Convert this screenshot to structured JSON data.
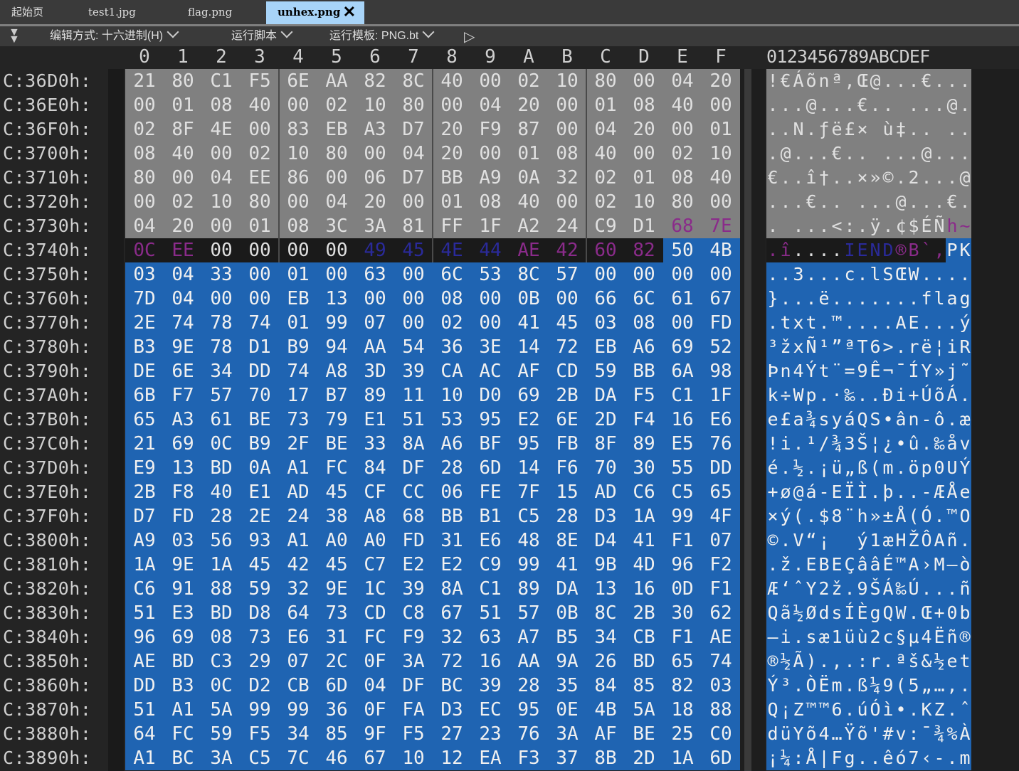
{
  "tabs": [
    {
      "label": "起始页",
      "active": false
    },
    {
      "label": "test1.jpg",
      "active": false
    },
    {
      "label": "flag.png",
      "active": false
    },
    {
      "label": "unhex.png",
      "active": true
    }
  ],
  "toolbar": {
    "edit_mode": "编辑方式: 十六进制(H)",
    "run_script": "运行脚本",
    "run_template": "运行模板: PNG.bt"
  },
  "column_headers": [
    "0",
    "1",
    "2",
    "3",
    "4",
    "5",
    "6",
    "7",
    "8",
    "9",
    "A",
    "B",
    "C",
    "D",
    "E",
    "F"
  ],
  "ascii_header": "0123456789ABCDEF",
  "colors": {
    "gray_bg": "#808080",
    "gray_fg": "#e0e0e0",
    "blue_bg": "#1f64b2",
    "blue_fg": "#f0f0f0",
    "black_bg": "#1a1a1a",
    "black_fg": "#e0e0e0",
    "purple_fg": "#8a2b8a",
    "navy_fg": "#2a2a9a"
  },
  "rows": [
    {
      "addr": "C:36D0h:",
      "hex": [
        "21",
        "80",
        "C1",
        "F5",
        "6E",
        "AA",
        "82",
        "8C",
        "40",
        "00",
        "02",
        "10",
        "80",
        "00",
        "04",
        "20"
      ],
      "ascii": "!€Áõnª‚Œ@...€..."
    },
    {
      "addr": "C:36E0h:",
      "hex": [
        "00",
        "01",
        "08",
        "40",
        "00",
        "02",
        "10",
        "80",
        "00",
        "04",
        "20",
        "00",
        "01",
        "08",
        "40",
        "00"
      ],
      "ascii": "...@...€.. ...@."
    },
    {
      "addr": "C:36F0h:",
      "hex": [
        "02",
        "8F",
        "4E",
        "00",
        "83",
        "EB",
        "A3",
        "D7",
        "20",
        "F9",
        "87",
        "00",
        "04",
        "20",
        "00",
        "01"
      ],
      "ascii": "..N.ƒë£× ù‡.. .."
    },
    {
      "addr": "C:3700h:",
      "hex": [
        "08",
        "40",
        "00",
        "02",
        "10",
        "80",
        "00",
        "04",
        "20",
        "00",
        "01",
        "08",
        "40",
        "00",
        "02",
        "10"
      ],
      "ascii": ".@...€.. ...@..."
    },
    {
      "addr": "C:3710h:",
      "hex": [
        "80",
        "00",
        "04",
        "EE",
        "86",
        "00",
        "06",
        "D7",
        "BB",
        "A9",
        "0A",
        "32",
        "02",
        "01",
        "08",
        "40"
      ],
      "ascii": "€..î†..×»©.2...@"
    },
    {
      "addr": "C:3720h:",
      "hex": [
        "00",
        "02",
        "10",
        "80",
        "00",
        "04",
        "20",
        "00",
        "01",
        "08",
        "40",
        "00",
        "02",
        "10",
        "80",
        "00"
      ],
      "ascii": "...€.. ...@...€."
    },
    {
      "addr": "C:3730h:",
      "hex": [
        "04",
        "20",
        "00",
        "01",
        "08",
        "3C",
        "3A",
        "81",
        "FF",
        "1F",
        "A2",
        "24",
        "C9",
        "D1",
        "68",
        "7E"
      ],
      "ascii": ". ...<:.ÿ.¢$ÉÑh~"
    },
    {
      "addr": "C:3740h:",
      "hex": [
        "0C",
        "EE",
        "00",
        "00",
        "00",
        "00",
        "49",
        "45",
        "4E",
        "44",
        "AE",
        "42",
        "60",
        "82",
        "50",
        "4B"
      ],
      "ascii": ".î....IEND®B`‚PK"
    },
    {
      "addr": "C:3750h:",
      "hex": [
        "03",
        "04",
        "33",
        "00",
        "01",
        "00",
        "63",
        "00",
        "6C",
        "53",
        "8C",
        "57",
        "00",
        "00",
        "00",
        "00"
      ],
      "ascii": "..3...c.lSŒW...."
    },
    {
      "addr": "C:3760h:",
      "hex": [
        "7D",
        "04",
        "00",
        "00",
        "EB",
        "13",
        "00",
        "00",
        "08",
        "00",
        "0B",
        "00",
        "66",
        "6C",
        "61",
        "67"
      ],
      "ascii": "}...ë.......flag"
    },
    {
      "addr": "C:3770h:",
      "hex": [
        "2E",
        "74",
        "78",
        "74",
        "01",
        "99",
        "07",
        "00",
        "02",
        "00",
        "41",
        "45",
        "03",
        "08",
        "00",
        "FD"
      ],
      "ascii": ".txt.™....AE...ý"
    },
    {
      "addr": "C:3780h:",
      "hex": [
        "B3",
        "9E",
        "78",
        "D1",
        "B9",
        "94",
        "AA",
        "54",
        "36",
        "3E",
        "14",
        "72",
        "EB",
        "A6",
        "69",
        "52"
      ],
      "ascii": "³žxÑ¹”ªT6>.rë¦iR"
    },
    {
      "addr": "C:3790h:",
      "hex": [
        "DE",
        "6E",
        "34",
        "DD",
        "74",
        "A8",
        "3D",
        "39",
        "CA",
        "AC",
        "AF",
        "CD",
        "59",
        "BB",
        "6A",
        "98"
      ],
      "ascii": "Þn4Ýt¨=9Ê¬¯ÍY»j˜"
    },
    {
      "addr": "C:37A0h:",
      "hex": [
        "6B",
        "F7",
        "57",
        "70",
        "17",
        "B7",
        "89",
        "11",
        "10",
        "D0",
        "69",
        "2B",
        "DA",
        "F5",
        "C1",
        "1F"
      ],
      "ascii": "k÷Wp.·‰..Ði+ÚõÁ."
    },
    {
      "addr": "C:37B0h:",
      "hex": [
        "65",
        "A3",
        "61",
        "BE",
        "73",
        "79",
        "E1",
        "51",
        "53",
        "95",
        "E2",
        "6E",
        "2D",
        "F4",
        "16",
        "E6"
      ],
      "ascii": "e£a¾syáQS•ân-ô.æ"
    },
    {
      "addr": "C:37C0h:",
      "hex": [
        "21",
        "69",
        "0C",
        "B9",
        "2F",
        "BE",
        "33",
        "8A",
        "A6",
        "BF",
        "95",
        "FB",
        "8F",
        "89",
        "E5",
        "76"
      ],
      "ascii": "!i.¹/¾3Š¦¿•û.‰åv"
    },
    {
      "addr": "C:37D0h:",
      "hex": [
        "E9",
        "13",
        "BD",
        "0A",
        "A1",
        "FC",
        "84",
        "DF",
        "28",
        "6D",
        "14",
        "F6",
        "70",
        "30",
        "55",
        "DD"
      ],
      "ascii": "é.½.¡ü„ß(m.öp0UÝ"
    },
    {
      "addr": "C:37E0h:",
      "hex": [
        "2B",
        "F8",
        "40",
        "E1",
        "AD",
        "45",
        "CF",
        "CC",
        "06",
        "FE",
        "7F",
        "15",
        "AD",
        "C6",
        "C5",
        "65"
      ],
      "ascii": "+ø@á-EÏÌ.þ..-ÆÅe"
    },
    {
      "addr": "C:37F0h:",
      "hex": [
        "D7",
        "FD",
        "28",
        "2E",
        "24",
        "38",
        "A8",
        "68",
        "BB",
        "B1",
        "C5",
        "28",
        "D3",
        "1A",
        "99",
        "4F"
      ],
      "ascii": "×ý(.$8¨h»±Å(Ó.™O"
    },
    {
      "addr": "C:3800h:",
      "hex": [
        "A9",
        "03",
        "56",
        "93",
        "A1",
        "A0",
        "A0",
        "FD",
        "31",
        "E6",
        "48",
        "8E",
        "D4",
        "41",
        "F1",
        "07"
      ],
      "ascii": "©.V“¡  ý1æHŽÔAñ."
    },
    {
      "addr": "C:3810h:",
      "hex": [
        "1A",
        "9E",
        "1A",
        "45",
        "42",
        "45",
        "C7",
        "E2",
        "E2",
        "C9",
        "99",
        "41",
        "9B",
        "4D",
        "96",
        "F2"
      ],
      "ascii": ".ž.EBEÇââÉ™A›M–ò"
    },
    {
      "addr": "C:3820h:",
      "hex": [
        "C6",
        "91",
        "88",
        "59",
        "32",
        "9E",
        "1C",
        "39",
        "8A",
        "C1",
        "89",
        "DA",
        "13",
        "16",
        "0D",
        "F1"
      ],
      "ascii": "Æ‘ˆY2ž.9ŠÁ‰Ú...ñ"
    },
    {
      "addr": "C:3830h:",
      "hex": [
        "51",
        "E3",
        "BD",
        "D8",
        "64",
        "73",
        "CD",
        "C8",
        "67",
        "51",
        "57",
        "0B",
        "8C",
        "2B",
        "30",
        "62"
      ],
      "ascii": "Qã½ØdsÍÈgQW.Œ+0b"
    },
    {
      "addr": "C:3840h:",
      "hex": [
        "96",
        "69",
        "08",
        "73",
        "E6",
        "31",
        "FC",
        "F9",
        "32",
        "63",
        "A7",
        "B5",
        "34",
        "CB",
        "F1",
        "AE"
      ],
      "ascii": "–i.sæ1üù2c§µ4Ëñ®"
    },
    {
      "addr": "C:3850h:",
      "hex": [
        "AE",
        "BD",
        "C3",
        "29",
        "07",
        "2C",
        "0F",
        "3A",
        "72",
        "16",
        "AA",
        "9A",
        "26",
        "BD",
        "65",
        "74"
      ],
      "ascii": "®½Ã).,.:r.ªš&½et"
    },
    {
      "addr": "C:3860h:",
      "hex": [
        "DD",
        "B3",
        "0C",
        "D2",
        "CB",
        "6D",
        "04",
        "DF",
        "BC",
        "39",
        "28",
        "35",
        "84",
        "85",
        "82",
        "03"
      ],
      "ascii": "Ý³.ÒËm.ß¼9(5„…‚."
    },
    {
      "addr": "C:3870h:",
      "hex": [
        "51",
        "A1",
        "5A",
        "99",
        "99",
        "36",
        "0F",
        "FA",
        "D3",
        "EC",
        "95",
        "0E",
        "4B",
        "5A",
        "18",
        "88"
      ],
      "ascii": "Q¡Z™™6.úÓì•.KZ.ˆ"
    },
    {
      "addr": "C:3880h:",
      "hex": [
        "64",
        "FC",
        "59",
        "F5",
        "34",
        "85",
        "9F",
        "F5",
        "27",
        "23",
        "76",
        "3A",
        "AF",
        "BE",
        "25",
        "C0"
      ],
      "ascii": "düYõ4…Ÿõ'#v:¯¾%À"
    },
    {
      "addr": "C:3890h:",
      "hex": [
        "A1",
        "BC",
        "3A",
        "C5",
        "7C",
        "46",
        "67",
        "10",
        "12",
        "EA",
        "F3",
        "37",
        "8B",
        "2D",
        "1A",
        "6D"
      ],
      "ascii": "¡¼:Å|Fg..êó7‹-.m"
    }
  ]
}
